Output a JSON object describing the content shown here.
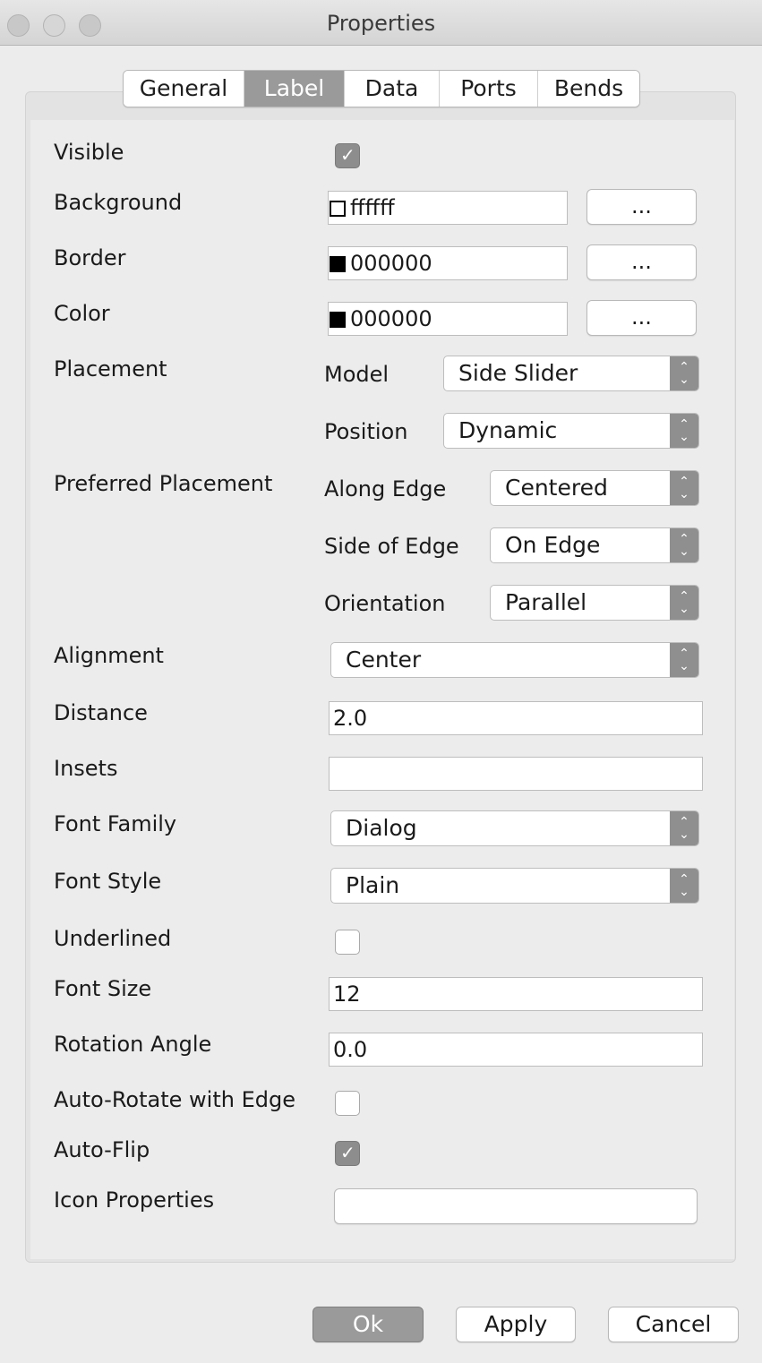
{
  "window": {
    "title": "Properties"
  },
  "tabs": [
    {
      "label": "General"
    },
    {
      "label": "Label"
    },
    {
      "label": "Data"
    },
    {
      "label": "Ports"
    },
    {
      "label": "Bends"
    }
  ],
  "active_tab": "Label",
  "labels": {
    "visible": "Visible",
    "background": "Background",
    "border": "Border",
    "color": "Color",
    "placement": "Placement",
    "preferred_placement": "Preferred Placement",
    "alignment": "Alignment",
    "distance": "Distance",
    "insets": "Insets",
    "font_family": "Font Family",
    "font_style": "Font Style",
    "underlined": "Underlined",
    "font_size": "Font Size",
    "rotation_angle": "Rotation Angle",
    "auto_rotate": "Auto-Rotate with Edge",
    "auto_flip": "Auto-Flip",
    "icon_properties": "Icon Properties"
  },
  "sublabels": {
    "model": "Model",
    "position": "Position",
    "along_edge": "Along Edge",
    "side_of_edge": "Side of Edge",
    "orientation": "Orientation"
  },
  "values": {
    "visible": true,
    "background": "ffffff",
    "border": "000000",
    "color": "000000",
    "model": "Side Slider",
    "position": "Dynamic",
    "along_edge": "Centered",
    "side_of_edge": "On Edge",
    "orientation": "Parallel",
    "alignment": "Center",
    "distance": "2.0",
    "insets": "",
    "font_family": "Dialog",
    "font_style": "Plain",
    "underlined": false,
    "font_size": "12",
    "rotation_angle": "0.0",
    "auto_rotate": false,
    "auto_flip": true,
    "icon_properties": ""
  },
  "swatch_colors": {
    "background": "#ffffff",
    "border": "#000000",
    "color": "#000000"
  },
  "picker_label": "...",
  "buttons": {
    "ok": "Ok",
    "apply": "Apply",
    "cancel": "Cancel"
  },
  "icons": {
    "arrow": "updown-chevron-icon",
    "check": "checkmark-icon"
  }
}
